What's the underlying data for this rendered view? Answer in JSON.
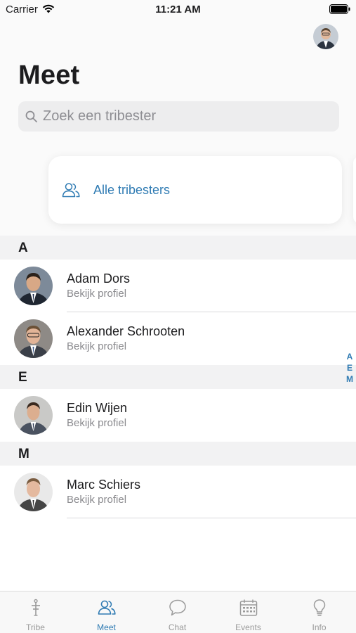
{
  "status_bar": {
    "carrier": "Carrier",
    "time": "11:21 AM"
  },
  "header": {
    "title": "Meet"
  },
  "search": {
    "placeholder": "Zoek een tribester"
  },
  "all_card": {
    "label": "Alle tribesters",
    "icon": "people-icon"
  },
  "sections": [
    {
      "letter": "A",
      "contacts": [
        {
          "name": "Adam Dors",
          "subtitle": "Bekijk profiel"
        },
        {
          "name": "Alexander Schrooten",
          "subtitle": "Bekijk profiel"
        }
      ]
    },
    {
      "letter": "E",
      "contacts": [
        {
          "name": "Edin Wijen",
          "subtitle": "Bekijk profiel"
        }
      ]
    },
    {
      "letter": "M",
      "contacts": [
        {
          "name": "Marc Schiers",
          "subtitle": "Bekijk profiel"
        }
      ]
    }
  ],
  "index_letters": [
    "A",
    "E",
    "M"
  ],
  "tab_bar": {
    "active": "Meet",
    "items": [
      {
        "label": "Tribe",
        "icon": "tribe-icon"
      },
      {
        "label": "Meet",
        "icon": "people-icon"
      },
      {
        "label": "Chat",
        "icon": "chat-bubble-icon"
      },
      {
        "label": "Events",
        "icon": "calendar-icon"
      },
      {
        "label": "Info",
        "icon": "lightbulb-icon"
      }
    ]
  },
  "colors": {
    "accent": "#2f7bb3",
    "inactive": "#9a9a9a",
    "section_bg": "#f2f2f3"
  }
}
